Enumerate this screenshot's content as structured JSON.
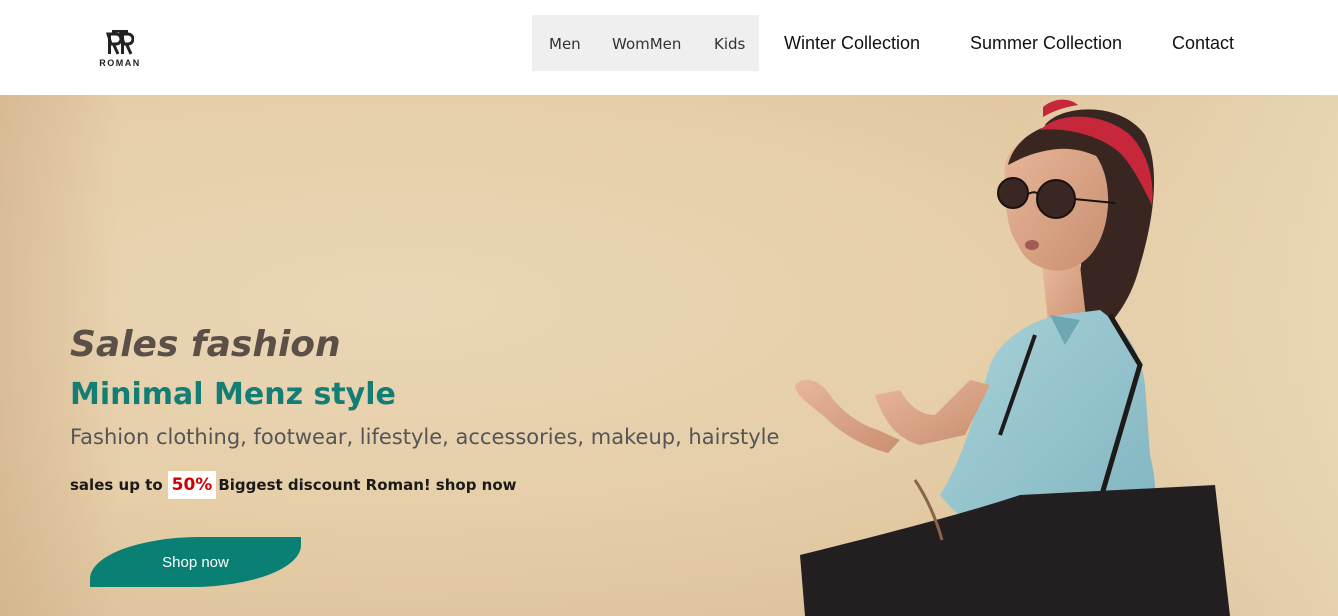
{
  "header": {
    "logo_text": "ROMAN",
    "nav_group": [
      "Men",
      "WomMen",
      "Kids"
    ],
    "nav_links": [
      "Winter Collection",
      "Summer Collection",
      "Contact"
    ]
  },
  "hero": {
    "title": "Sales fashion",
    "subtitle": "Minimal Menz style",
    "description": "Fashion clothing, footwear, lifestyle, accessories, makeup, hairstyle",
    "promo_prefix": "sales up to",
    "promo_percent": "50%",
    "promo_middle": "Biggest discount Roman!",
    "promo_suffix": "shop now",
    "button_label": "Shop now"
  },
  "colors": {
    "accent": "#0a7f74",
    "subtitle": "#137e74",
    "discount": "#d10000",
    "nav_group_bg": "#efefef",
    "hero_bg": "#e6cfa9"
  },
  "icons": {
    "logo": "roman-logo-icon"
  }
}
